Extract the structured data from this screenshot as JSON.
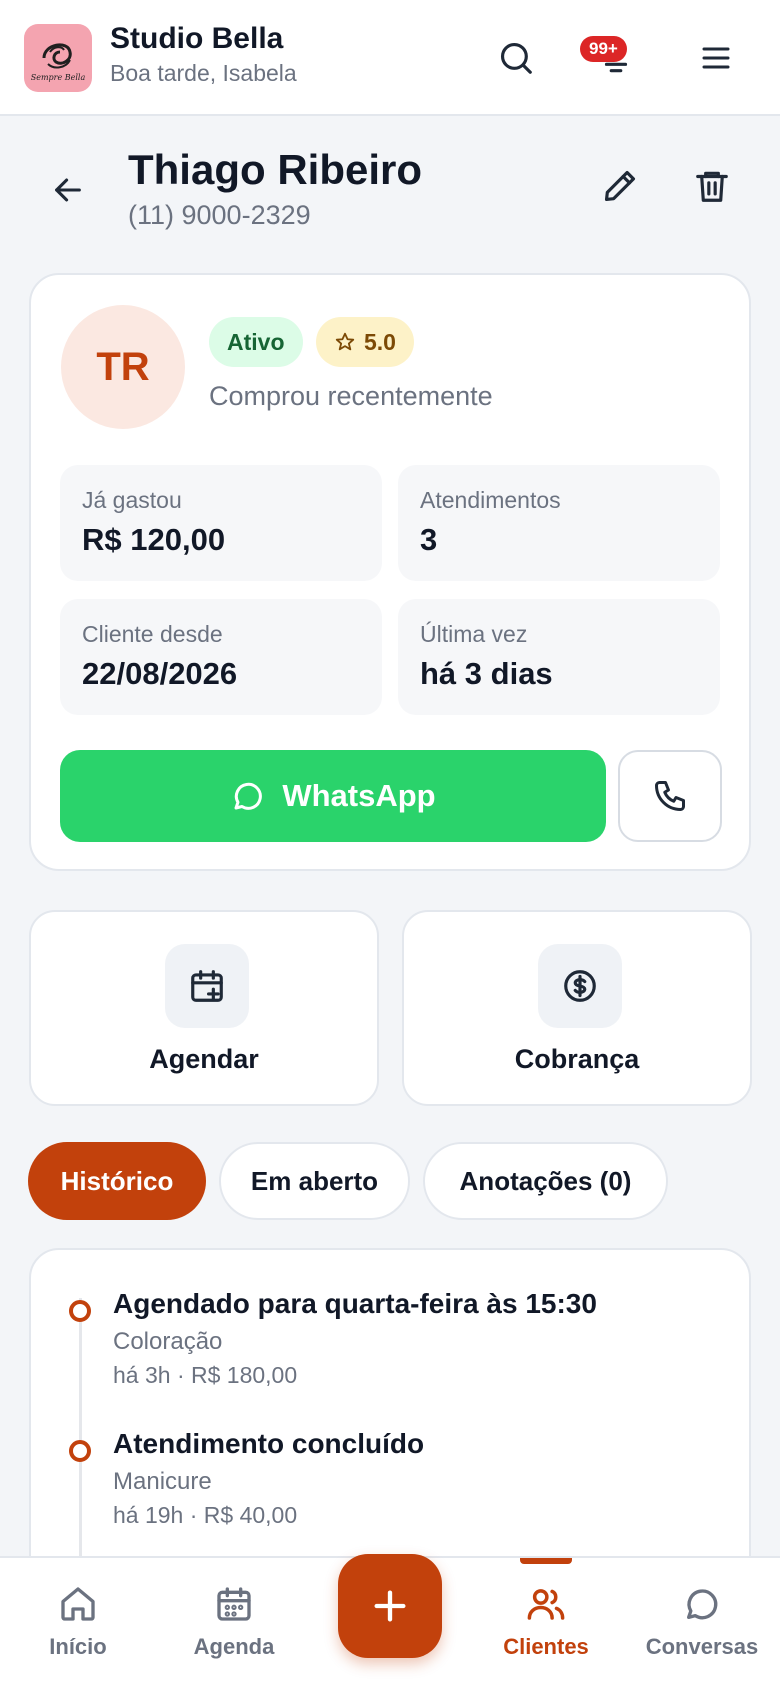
{
  "app": {
    "name": "Studio Bella",
    "greeting": "Boa tarde, Isabela",
    "logo_text": "Sempre Bella",
    "notifications_badge": "99+"
  },
  "client": {
    "name": "Thiago Ribeiro",
    "phone": "(11) 9000-2329",
    "initials": "TR",
    "status": "Ativo",
    "rating": "5.0",
    "note": "Comprou recentemente",
    "stats": [
      {
        "label": "Já gastou",
        "value": "R$ 120,00"
      },
      {
        "label": "Atendimentos",
        "value": "3"
      },
      {
        "label": "Cliente desde",
        "value": "22/08/2026"
      },
      {
        "label": "Última vez",
        "value": "há 3 dias"
      }
    ],
    "whatsapp_label": "WhatsApp"
  },
  "quick_actions": [
    {
      "label": "Agendar",
      "icon": "calendar-plus-icon"
    },
    {
      "label": "Cobrança",
      "icon": "dollar-circle-icon"
    }
  ],
  "tabs": [
    {
      "label": "Histórico",
      "active": true
    },
    {
      "label": "Em aberto",
      "active": false
    },
    {
      "label": "Anotações (0)",
      "active": false
    }
  ],
  "history": [
    {
      "title": "Agendado para quarta-feira às 15:30",
      "service": "Coloração",
      "meta": "há 3h · R$ 180,00"
    },
    {
      "title": "Atendimento concluído",
      "service": "Manicure",
      "meta": "há 19h · R$ 40,00"
    }
  ],
  "bottom_nav": [
    {
      "label": "Início",
      "icon": "home-icon",
      "active": false
    },
    {
      "label": "Agenda",
      "icon": "calendar-icon",
      "active": false
    },
    {
      "label": "Clientes",
      "icon": "users-icon",
      "active": true
    },
    {
      "label": "Conversas",
      "icon": "chat-icon",
      "active": false
    }
  ],
  "colors": {
    "accent": "#c2410c",
    "whatsapp": "#2ad36b",
    "active_bg": "#dcfce7",
    "rating_bg": "#fdf2c8"
  }
}
